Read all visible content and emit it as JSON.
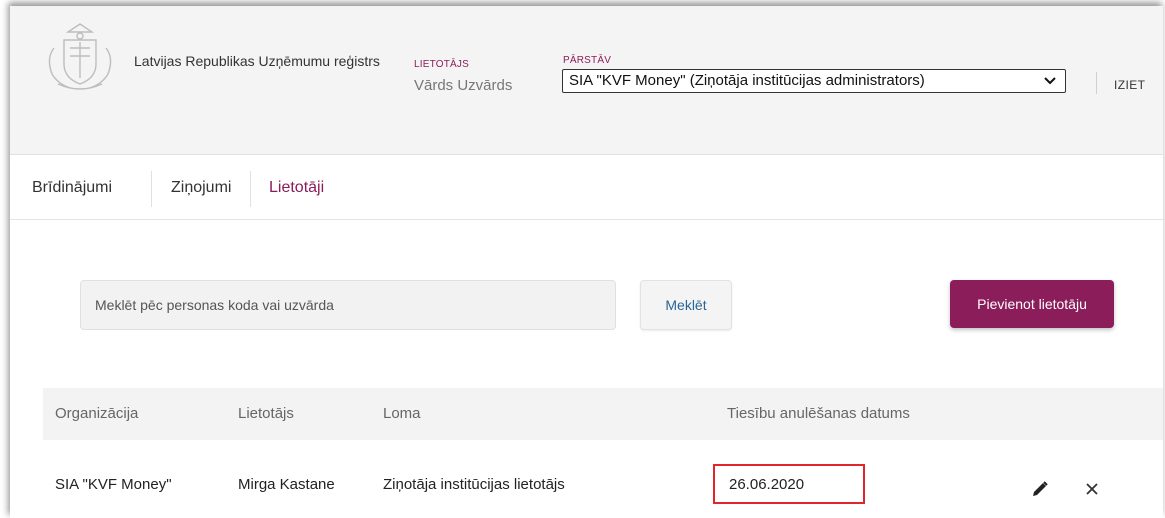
{
  "header": {
    "org_name": "Latvijas Republikas Uzņēmumu reģistrs",
    "user_label": "LIETOTĀJS",
    "user_name": "Vārds Uzvārds",
    "represents_label": "PĀRSTĀV",
    "represents_value": "SIA \"KVF Money\" (Ziņotāja institūcijas administrators)",
    "logout": "IZIET"
  },
  "tabs": [
    {
      "label": "Brīdinājumi",
      "active": false
    },
    {
      "label": "Ziņojumi",
      "active": false
    },
    {
      "label": "Lietotāji",
      "active": true
    }
  ],
  "search": {
    "placeholder": "Meklēt pēc personas koda vai uzvārda",
    "button": "Meklēt"
  },
  "add_button": "Pievienot lietotāju",
  "table": {
    "columns": [
      "Organizācija",
      "Lietotājs",
      "Loma",
      "Tiesību anulēšanas datums"
    ],
    "rows": [
      {
        "organization": "SIA \"KVF Money\"",
        "user": "Mirga Kastane",
        "role": "Ziņotāja institūcijas lietotājs",
        "revoke_date": "26.06.2020"
      }
    ]
  },
  "colors": {
    "accent": "#8b1d5b",
    "highlight": "#e0262c"
  },
  "icons": {
    "edit": "pencil-icon",
    "delete": "close-icon",
    "select": "chevron-down-icon"
  }
}
